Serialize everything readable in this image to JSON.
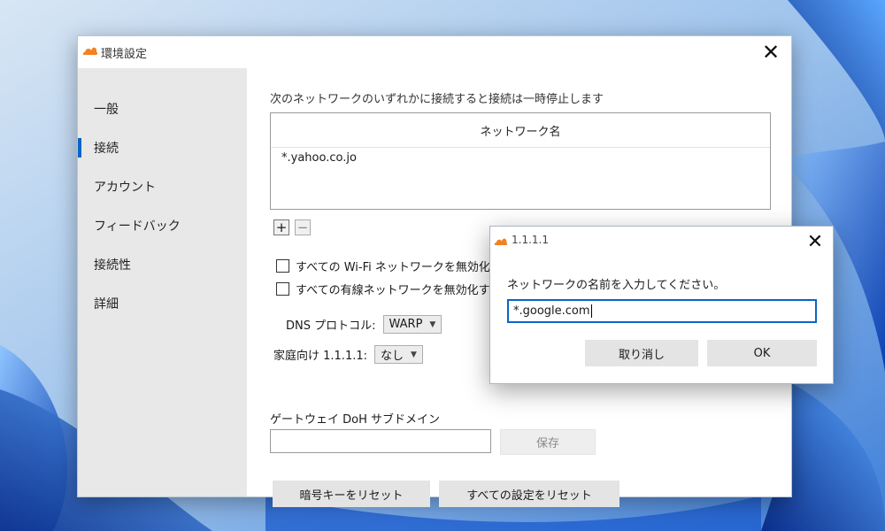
{
  "settings_window": {
    "title": "環境設定",
    "close_glyph": "✕",
    "sidebar": {
      "active_index": 1,
      "items": [
        {
          "label": "一般"
        },
        {
          "label": "接続"
        },
        {
          "label": "アカウント"
        },
        {
          "label": "フィードバック"
        },
        {
          "label": "接続性"
        },
        {
          "label": "詳細"
        }
      ]
    },
    "connection": {
      "heading": "次のネットワークのいずれかに接続すると接続は一時停止します",
      "table_header": "ネットワーク名",
      "networks": [
        "*.yahoo.co.jo"
      ],
      "add_glyph": "+",
      "remove_glyph": "−",
      "wifi_checkbox_label": "すべての Wi-Fi ネットワークを無効化する",
      "wired_checkbox_label": "すべての有線ネットワークを無効化する",
      "wifi_checked": false,
      "wired_checked": false,
      "dns_protocol_label": "DNS プロトコル:",
      "dns_protocol_value": "WARP",
      "families_label": "家庭向け 1.1.1.1:",
      "families_value": "なし",
      "doh_label": "ゲートウェイ DoH サブドメイン",
      "doh_value": "",
      "save_label": "保存",
      "reset_keys_label": "暗号キーをリセット",
      "reset_all_label": "すべての設定をリセット"
    }
  },
  "dialog": {
    "title": "1.1.1.1",
    "close_glyph": "✕",
    "prompt": "ネットワークの名前を入力してください。",
    "input_value": "*.google.com",
    "cancel_label": "取り消し",
    "ok_label": "OK"
  },
  "colors": {
    "accent": "#0a64c8",
    "cloudflare_orange": "#f48120",
    "sidebar_bg": "#e8e8e8"
  }
}
